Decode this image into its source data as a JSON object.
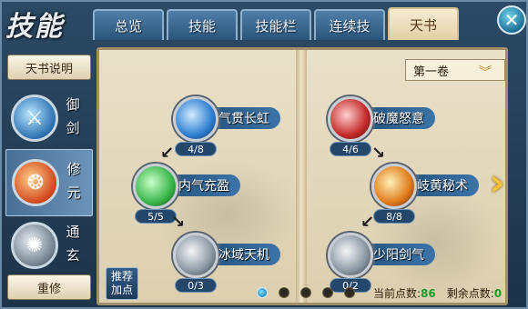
{
  "title": "技能",
  "tabs": [
    {
      "label": "总览",
      "active": false
    },
    {
      "label": "技能",
      "active": false
    },
    {
      "label": "技能栏",
      "active": false
    },
    {
      "label": "连续技",
      "active": false
    },
    {
      "label": "天书",
      "active": true
    }
  ],
  "left_panel": {
    "explain_label": "天书说明",
    "reset_label": "重修",
    "categories": [
      {
        "label_1": "御",
        "label_2": "剑",
        "icon": "sword-sigil-icon",
        "active": false
      },
      {
        "label_1": "修",
        "label_2": "元",
        "icon": "fire-sigil-icon",
        "active": true
      },
      {
        "label_1": "通",
        "label_2": "玄",
        "icon": "mystic-sigil-icon",
        "active": false
      }
    ]
  },
  "book": {
    "volume": "第一卷",
    "skills": [
      {
        "name": "气贯长虹",
        "count": "4/8",
        "icon": "blue-slash-icon",
        "color": "#2f7fd0"
      },
      {
        "name": "内气充盈",
        "count": "5/5",
        "icon": "green-figure-icon",
        "color": "#39b54a"
      },
      {
        "name": "冰域天机",
        "count": "0/3",
        "icon": "ice-claw-icon",
        "color": "#8a96a2"
      },
      {
        "name": "破魔怒意",
        "count": "4/6",
        "icon": "red-strike-icon",
        "color": "#c42a2a"
      },
      {
        "name": "岐黄秘术",
        "count": "8/8",
        "icon": "fire-burst-icon",
        "color": "#e07a1a"
      },
      {
        "name": "少阳剑气",
        "count": "0/2",
        "icon": "gray-blade-icon",
        "color": "#8a96a2"
      }
    ]
  },
  "recommend_label_1": "推荐",
  "recommend_label_2": "加点",
  "pages": {
    "total": 5,
    "current": 1
  },
  "points": {
    "current_label": "当前点数:",
    "current_value": "86",
    "remaining_label": "剩余点数:",
    "remaining_value": "0"
  }
}
